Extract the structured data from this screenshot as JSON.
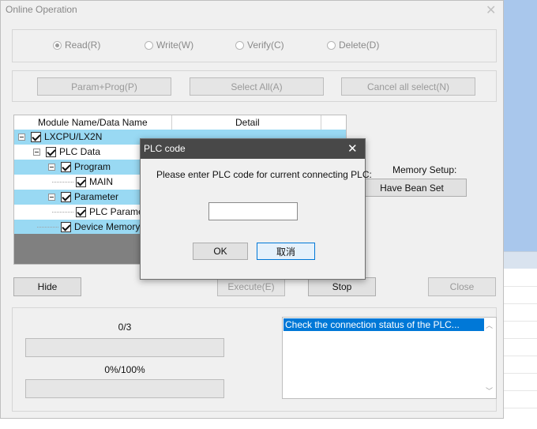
{
  "window": {
    "title": "Online Operation",
    "close_glyph": "✕"
  },
  "mode": {
    "options": [
      {
        "label": "Read(R)",
        "selected": true
      },
      {
        "label": "Write(W)",
        "selected": false
      },
      {
        "label": "Verify(C)",
        "selected": false
      },
      {
        "label": "Delete(D)",
        "selected": false
      }
    ]
  },
  "select_buttons": {
    "param_prog": "Param+Prog(P)",
    "select_all": "Select All(A)",
    "cancel_all": "Cancel all select(N)"
  },
  "tree": {
    "columns": [
      "Module Name/Data Name",
      "Detail"
    ],
    "items": [
      {
        "label": "LXCPU/LX2N",
        "checked": true
      },
      {
        "label": "PLC Data",
        "checked": true
      },
      {
        "label": "Program",
        "checked": true
      },
      {
        "label": "MAIN",
        "checked": true
      },
      {
        "label": "Parameter",
        "checked": true
      },
      {
        "label": "PLC Parame",
        "checked": true
      },
      {
        "label": "Device Memory",
        "checked": true
      }
    ]
  },
  "memory": {
    "label": "Memory Setup:",
    "button": "Have Bean Set"
  },
  "actions": {
    "hide": "Hide",
    "execute": "Execute(E)",
    "stop": "Stop",
    "close": "Close"
  },
  "progress": {
    "count": "0/3",
    "count_fraction": 0,
    "percent": "0%/100%",
    "percent_fraction": 0
  },
  "log": {
    "lines": [
      "Check the connection status of the PLC..."
    ]
  },
  "dialog": {
    "title": "PLC code",
    "close_glyph": "✕",
    "message": "Please enter PLC code for current connecting PLC:",
    "code_value": "",
    "ok": "OK",
    "cancel": "取消"
  },
  "colors": {
    "selection": "#99d9f3",
    "log_highlight": "#0078d7",
    "dialog_title_bar": "#484848"
  }
}
